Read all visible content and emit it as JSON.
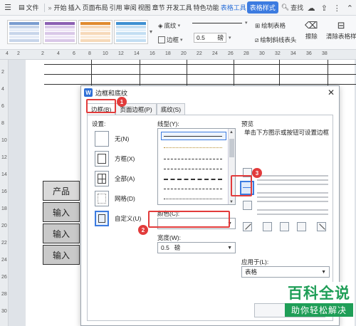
{
  "menubar": {
    "file_label": "文件",
    "tabs": [
      "开始",
      "插入",
      "页面布局",
      "引用",
      "审阅",
      "视图",
      "章节",
      "开发工具",
      "特色功能"
    ],
    "table_tools_label": "表格工具",
    "table_style_label": "表格样式",
    "search_label": "查找"
  },
  "ribbon": {
    "shading_label": "底纹",
    "border_label": "边框",
    "line_width_value": "0.5",
    "line_width_unit": "磅",
    "draw_table_label": "绘制表格",
    "draw_diagonal_label": "绘制斜线表头",
    "erase_label": "擦除",
    "clear_style_label": "清除表格样"
  },
  "ruler": {
    "h_marks": [
      "4",
      "2",
      "2",
      "4",
      "6",
      "8",
      "10",
      "12",
      "14",
      "16",
      "18",
      "20",
      "22",
      "24",
      "26",
      "28",
      "30",
      "32",
      "34",
      "36",
      "38"
    ],
    "v_marks": [
      "2",
      "4",
      "6",
      "8",
      "10",
      "12",
      "14",
      "16",
      "18",
      "20",
      "22",
      "24",
      "26",
      "28",
      "30"
    ]
  },
  "document": {
    "cell_header": "产品",
    "cell_rows": [
      "输入",
      "输入",
      "输入"
    ]
  },
  "dialog": {
    "title": "边框和底纹",
    "tabs": [
      "边框(B)",
      "页面边框(P)",
      "底纹(S)"
    ],
    "settings_label": "设置:",
    "settings": [
      "无(N)",
      "方框(X)",
      "全部(A)",
      "网格(D)",
      "自定义(U)"
    ],
    "line_style_label": "线型(Y):",
    "color_label": "颜色(C):",
    "width_label": "宽度(W):",
    "width_value": "0.5",
    "width_unit": "磅",
    "preview_label": "预览",
    "preview_hint": "单击下方图示或按钮可设置边框",
    "apply_label": "应用于(L):",
    "apply_value": "表格"
  },
  "badges": [
    "1",
    "2",
    "3"
  ],
  "watermark": {
    "title": "百科全说",
    "subtitle": "助你轻松解决"
  },
  "colors": {
    "accent": "#3c7be0",
    "highlight_red": "#e23b3b",
    "watermark_green": "#1f9e57"
  }
}
